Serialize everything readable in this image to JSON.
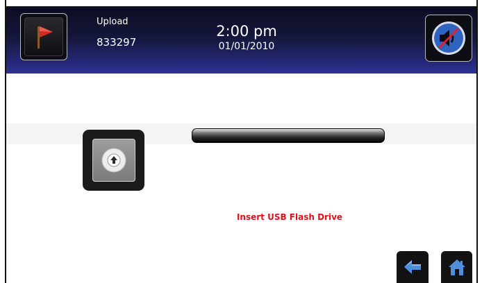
{
  "header": {
    "mode_label": "Upload",
    "code_value": "833297",
    "clock_time": "2:00 pm",
    "clock_date": "01/01/2010"
  },
  "icons": {
    "flag": "red-flag-icon",
    "sound": "speaker-muted-icon",
    "upload": "upload-arrow-icon",
    "back": "back-arrow-icon",
    "home": "home-icon"
  },
  "progress": {
    "fraction": 0
  },
  "status": {
    "message": "Insert USB Flash Drive"
  },
  "colors": {
    "header_gradient_top": "#0c0d22",
    "header_gradient_bottom": "#2d3296",
    "status_text": "#e0101a",
    "flag": "#d42a22",
    "sound_circle": "#2f63c0",
    "nav_icon": "#4f8fdc"
  }
}
